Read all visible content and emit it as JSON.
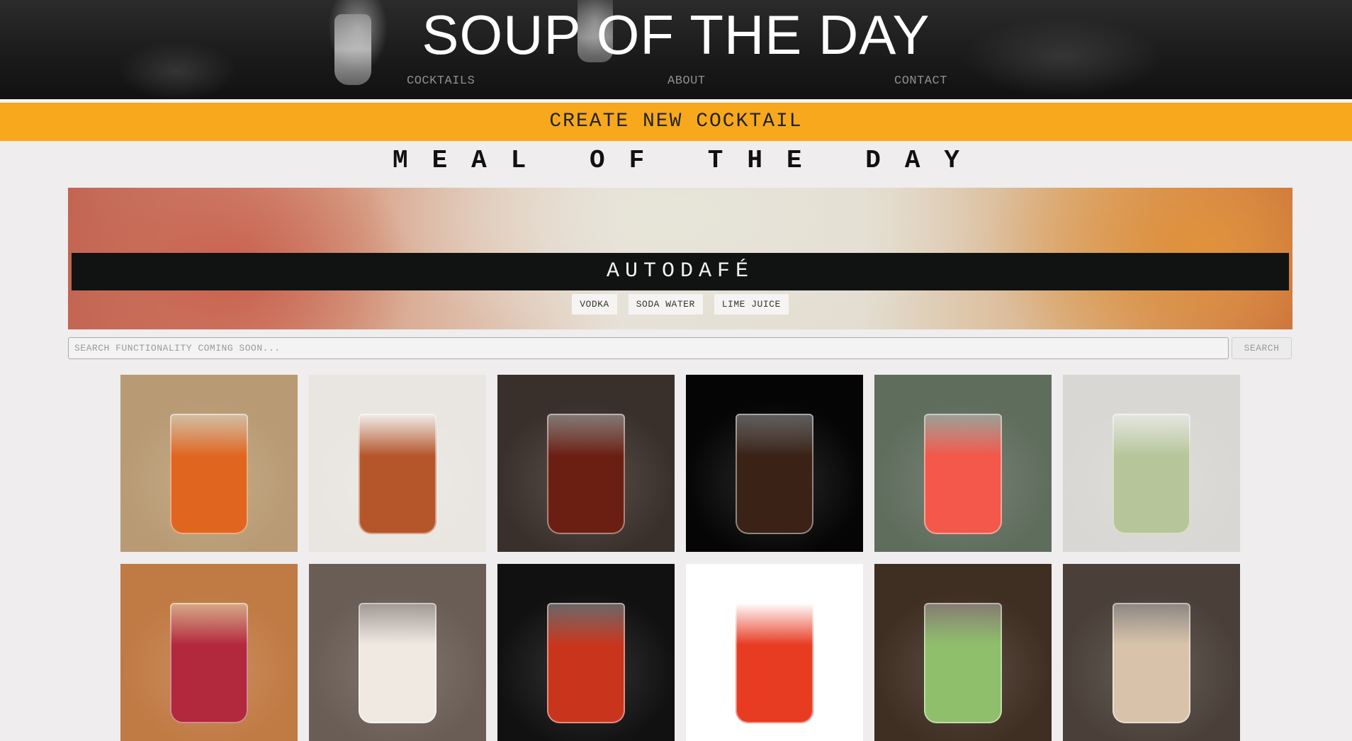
{
  "header": {
    "title": "SOUP OF THE DAY",
    "nav": [
      {
        "label": "COCKTAILS"
      },
      {
        "label": "ABOUT"
      },
      {
        "label": "CONTACT"
      }
    ]
  },
  "create_button": {
    "label": "CREATE NEW COCKTAIL"
  },
  "meal_of_the_day": {
    "heading": "MEAL OF THE DAY",
    "cocktail_name": "AUTODAFÉ",
    "ingredients": [
      "VODKA",
      "SODA WATER",
      "LIME JUICE"
    ]
  },
  "search": {
    "placeholder": "SEARCH FUNCTIONALITY COMING SOON...",
    "button_label": "SEARCH"
  },
  "colors": {
    "accent": "#f8a81c",
    "page_background": "#efeded",
    "banner_dark": "#111313"
  },
  "cocktail_grid": [
    {
      "name": "cocktail-photo-1",
      "bg": "#b89b74",
      "drink": "#e0661f"
    },
    {
      "name": "cocktail-photo-2",
      "bg": "#e9e6e1",
      "drink": "#b5552a"
    },
    {
      "name": "cocktail-photo-3",
      "bg": "#3a302b",
      "drink": "#6b1f12"
    },
    {
      "name": "cocktail-photo-4",
      "bg": "#050505",
      "drink": "#3a2216"
    },
    {
      "name": "cocktail-photo-5",
      "bg": "#5f6d5d",
      "drink": "#f3584a"
    },
    {
      "name": "cocktail-photo-6",
      "bg": "#d9d7d3",
      "drink": "#b6c69a"
    },
    {
      "name": "cocktail-photo-7",
      "bg": "#c07a43",
      "drink": "#b2283c"
    },
    {
      "name": "cocktail-photo-8",
      "bg": "#6a5d55",
      "drink": "#efe9e2"
    },
    {
      "name": "cocktail-photo-9",
      "bg": "#111111",
      "drink": "#c9351c"
    },
    {
      "name": "cocktail-photo-10",
      "bg": "#ffffff",
      "drink": "#e73b22"
    },
    {
      "name": "cocktail-photo-11",
      "bg": "#3f2e22",
      "drink": "#8fbf6a"
    },
    {
      "name": "cocktail-photo-12",
      "bg": "#4a4039",
      "drink": "#d8c3aa"
    }
  ]
}
